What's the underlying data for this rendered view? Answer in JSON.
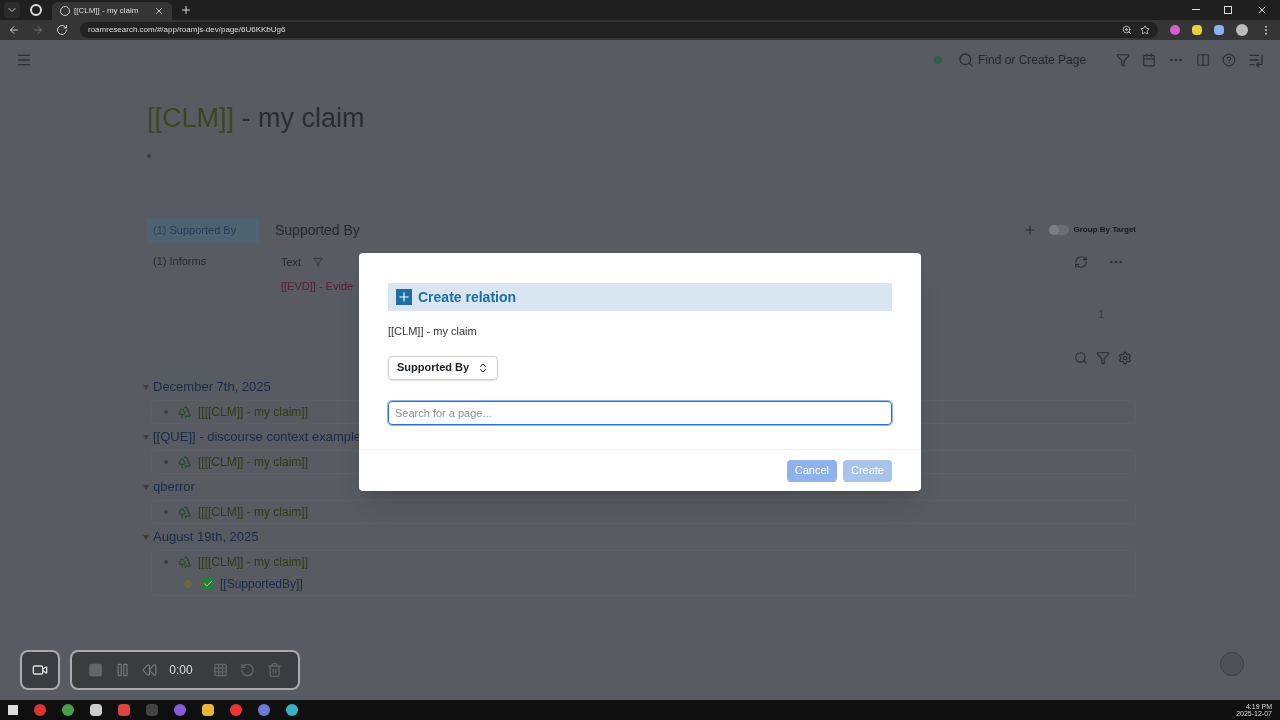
{
  "browser": {
    "tabs": [
      {
        "title": "[[CLM]] - my claim",
        "selected": true
      }
    ],
    "url": "roamresearch.com/#/app/roamjs-dev/page/6U6KKbUg6"
  },
  "topbar": {
    "search_placeholder": "Find or Create Page"
  },
  "page": {
    "title_link": "[[CLM]]",
    "title_rest": " - my claim"
  },
  "discourse_context": {
    "relations": [
      {
        "label": "(1) Supported By",
        "selected": true
      },
      {
        "label": "(1) Informs",
        "selected": false
      }
    ],
    "heading": "Supported By",
    "toggle": {
      "label": "Group By Target",
      "on": false
    },
    "table": {
      "column": "Text",
      "rows": [
        "[[EVD]] - Evide"
      ],
      "page": "1"
    }
  },
  "references": [
    {
      "title": "December 7th, 2025",
      "children": [
        {
          "kind": "claim",
          "text": "[[[[CLM]] - my claim]]"
        }
      ]
    },
    {
      "title": "[[QUE]] - discourse context example",
      "children": [
        {
          "kind": "claim",
          "text": "[[[[CLM]] - my claim]]"
        }
      ]
    },
    {
      "title": "qberror",
      "children": [
        {
          "kind": "claim",
          "text": "[[[[CLM]] - my claim]]"
        }
      ]
    },
    {
      "title": "August 19th, 2025",
      "children": [
        {
          "kind": "claim",
          "text": "[[[[CLM]] - my claim]]",
          "children": [
            {
              "kind": "relation",
              "text": "[[SupportedBy]]"
            }
          ]
        }
      ]
    }
  ],
  "recorder": {
    "time": "0:00"
  },
  "modal": {
    "title": "Create relation",
    "source": "[[CLM]] - my claim",
    "relation": "Supported By",
    "search_placeholder": "Search for a page...",
    "buttons": [
      {
        "label": "Cancel",
        "disabled": false
      },
      {
        "label": "Create",
        "disabled": true
      }
    ]
  },
  "taskbar": {
    "time": "4:19 PM",
    "date": "2025-12-07"
  }
}
